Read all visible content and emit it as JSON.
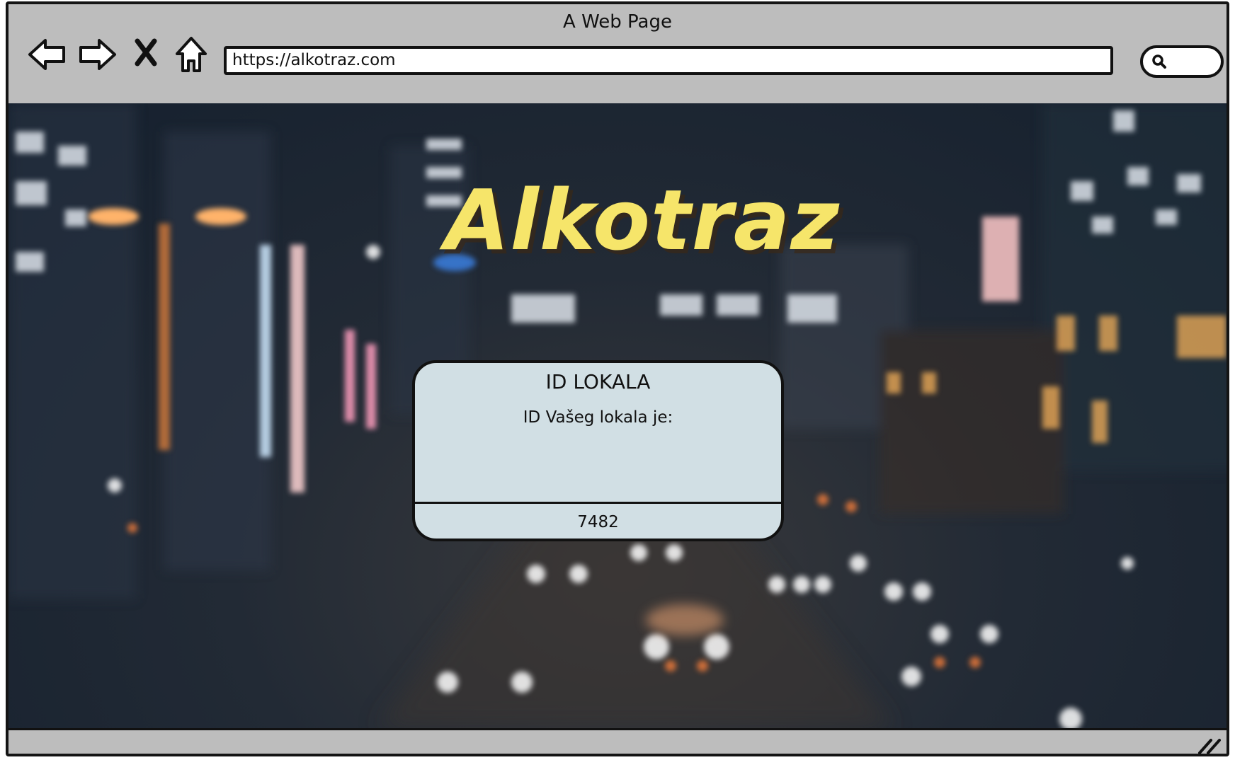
{
  "window": {
    "title": "A Web Page"
  },
  "toolbar": {
    "back_icon": "back-arrow-icon",
    "forward_icon": "forward-arrow-icon",
    "stop_icon": "close-icon",
    "home_icon": "home-icon",
    "url": "https://alkotraz.com",
    "search_icon": "search-icon"
  },
  "page": {
    "brand": "Alkotraz",
    "background": "blurred night city street",
    "dialog": {
      "title": "ID LOKALA",
      "message": "ID Vašeg lokala je:",
      "value": "7482"
    }
  },
  "colors": {
    "chrome": "#bdbdbd",
    "brand": "#f6e56a",
    "dialog": "#d1dfe4",
    "outline": "#111111"
  }
}
